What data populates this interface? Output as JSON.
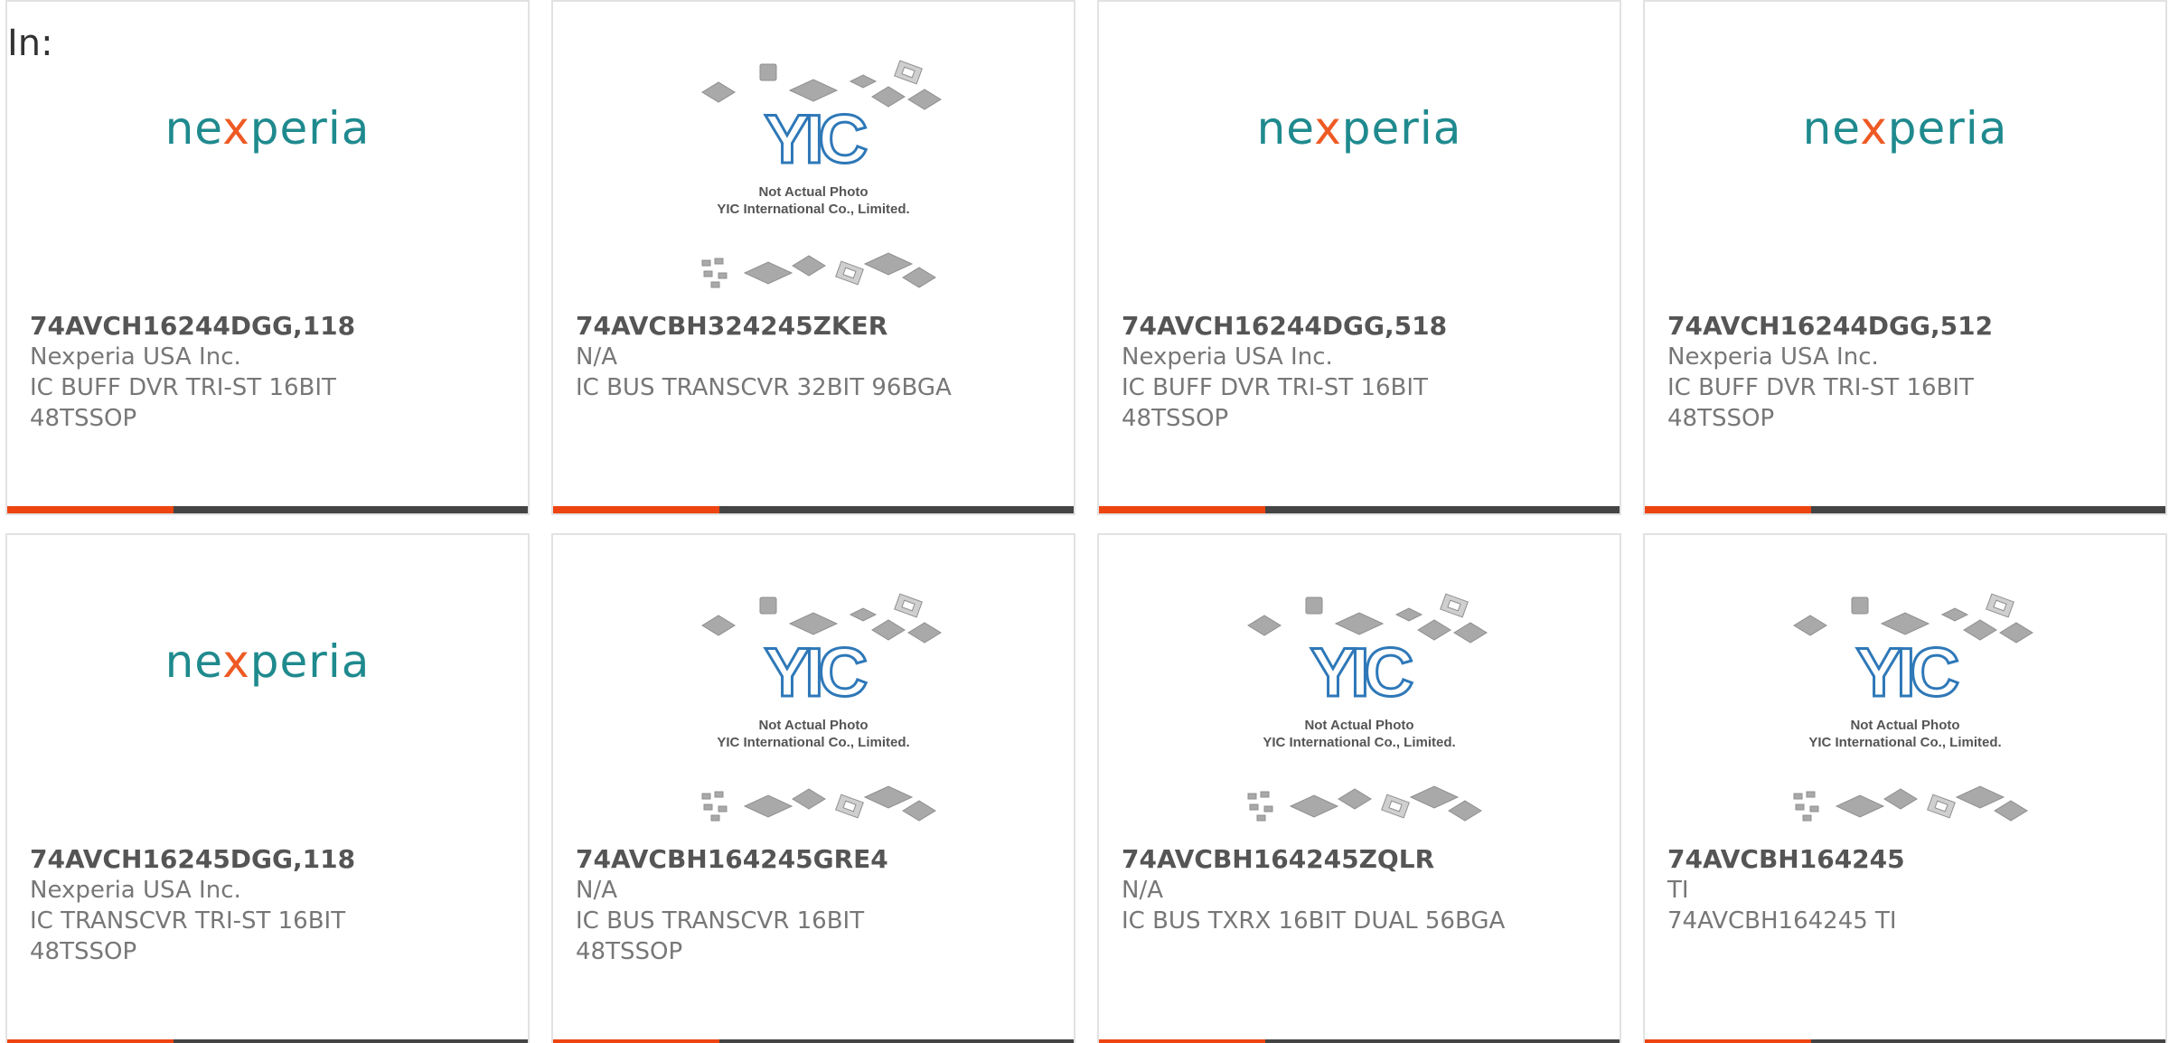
{
  "header": {
    "label": "In:"
  },
  "colors": {
    "accent": "#ee4411",
    "bar": "#444444",
    "brand": "#1f8a8e",
    "brand_x": "#ee5a24"
  },
  "placeholder_image": {
    "line1": "Not Actual Photo",
    "line2": "YIC International Co., Limited.",
    "logo_text": "YIC"
  },
  "cards": [
    {
      "image": "nexperia-logo",
      "logo": {
        "pre": "ne",
        "x": "x",
        "post": "peria"
      },
      "part_number": "74AVCH16244DGG,118",
      "manufacturer": "Nexperia USA Inc.",
      "description_line1": "IC BUFF DVR TRI-ST 16BIT",
      "description_line2": "48TSSOP"
    },
    {
      "image": "yic-placeholder",
      "part_number": "74AVCBH324245ZKER",
      "manufacturer": "N/A",
      "description_line1": "IC BUS TRANSCVR 32BIT 96BGA",
      "description_line2": ""
    },
    {
      "image": "nexperia-logo",
      "logo": {
        "pre": "ne",
        "x": "x",
        "post": "peria"
      },
      "part_number": "74AVCH16244DGG,518",
      "manufacturer": "Nexperia USA Inc.",
      "description_line1": "IC BUFF DVR TRI-ST 16BIT",
      "description_line2": "48TSSOP"
    },
    {
      "image": "nexperia-logo",
      "logo": {
        "pre": "ne",
        "x": "x",
        "post": "peria"
      },
      "part_number": "74AVCH16244DGG,512",
      "manufacturer": "Nexperia USA Inc.",
      "description_line1": "IC BUFF DVR TRI-ST 16BIT",
      "description_line2": "48TSSOP"
    },
    {
      "image": "nexperia-logo",
      "logo": {
        "pre": "ne",
        "x": "x",
        "post": "peria"
      },
      "part_number": "74AVCH16245DGG,118",
      "manufacturer": "Nexperia USA Inc.",
      "description_line1": "IC TRANSCVR TRI-ST 16BIT",
      "description_line2": "48TSSOP"
    },
    {
      "image": "yic-placeholder",
      "part_number": "74AVCBH164245GRE4",
      "manufacturer": "N/A",
      "description_line1": "IC BUS TRANSCVR 16BIT",
      "description_line2": "48TSSOP"
    },
    {
      "image": "yic-placeholder",
      "part_number": "74AVCBH164245ZQLR",
      "manufacturer": "N/A",
      "description_line1": "IC BUS TXRX 16BIT DUAL 56BGA",
      "description_line2": ""
    },
    {
      "image": "yic-placeholder",
      "part_number": "74AVCBH164245",
      "manufacturer": "TI",
      "description_line1": "74AVCBH164245 TI",
      "description_line2": ""
    }
  ]
}
